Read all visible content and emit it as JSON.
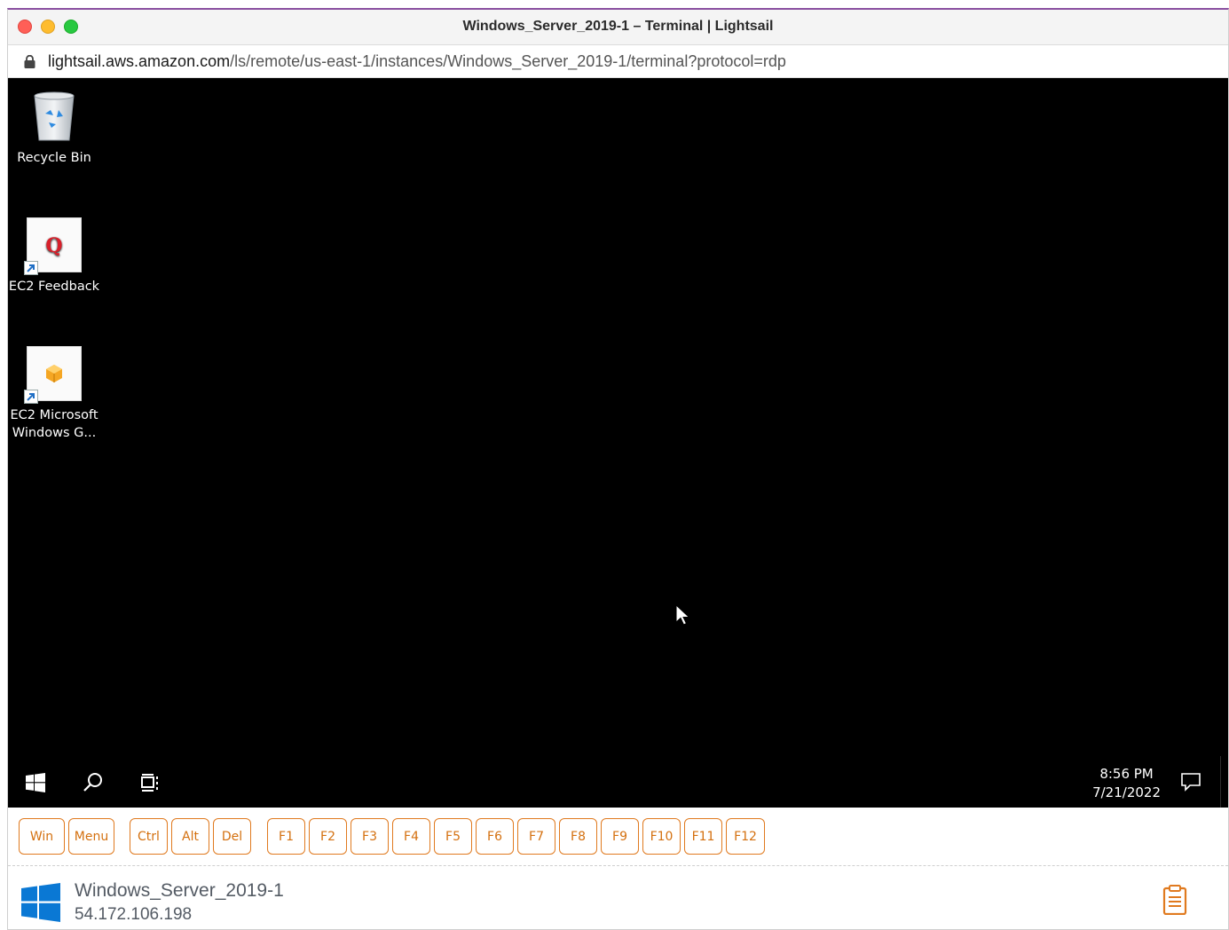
{
  "window": {
    "title": "Windows_Server_2019-1 – Terminal | Lightsail"
  },
  "urlbar": {
    "host": "lightsail.aws.amazon.com",
    "path": "/ls/remote/us-east-1/instances/Windows_Server_2019-1/terminal?protocol=rdp"
  },
  "desktop": {
    "icons": [
      {
        "label": "Recycle Bin",
        "icon": "recycle-bin-icon"
      },
      {
        "label": "EC2 Feedback",
        "icon": "ec2-feedback-icon"
      },
      {
        "label_line1": "EC2 Microsoft",
        "label_line2": "Windows G...",
        "icon": "ec2-guide-icon"
      }
    ]
  },
  "taskbar": {
    "time": "8:56 PM",
    "date": "7/21/2022"
  },
  "keys": {
    "win": "Win",
    "menu": "Menu",
    "ctrl": "Ctrl",
    "alt": "Alt",
    "del": "Del",
    "f1": "F1",
    "f2": "F2",
    "f3": "F3",
    "f4": "F4",
    "f5": "F5",
    "f6": "F6",
    "f7": "F7",
    "f8": "F8",
    "f9": "F9",
    "f10": "F10",
    "f11": "F11",
    "f12": "F12"
  },
  "instance": {
    "name": "Windows_Server_2019-1",
    "ip": "54.172.106.198"
  },
  "colors": {
    "accent": "#e07a1f",
    "windows_blue": "#0a78d4",
    "desktop_bg": "#000000"
  }
}
